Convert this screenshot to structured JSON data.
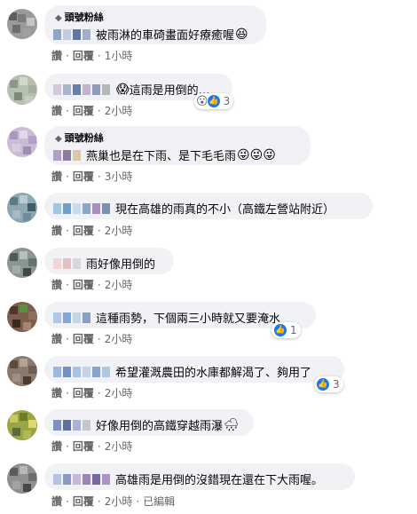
{
  "actions": {
    "like": "讚",
    "reply": "回覆",
    "sep": "·",
    "edited": "已編輯"
  },
  "comments": [
    {
      "badge": "頭號粉絲",
      "badge_icon": "diamond-icon",
      "text": "被雨淋的車碕畫面好療癒喔",
      "emoji": "😆",
      "time": "1小時"
    },
    {
      "text": "這雨是用倒的…",
      "emoji_prefix": "😱",
      "time": "2小時",
      "reactions": {
        "icons": [
          "wow-icon",
          "like-icon"
        ],
        "count": "3"
      }
    },
    {
      "badge": "頭號粉絲",
      "badge_icon": "diamond-icon",
      "text": "燕巢也是在下雨、是下毛毛雨",
      "emoji": "😜😜😜",
      "time": "3小時"
    },
    {
      "text": "現在高雄的雨真的不小（高鐵左營站附近）",
      "time": "2小時"
    },
    {
      "text": "雨好像用倒的",
      "time": "2小時"
    },
    {
      "text": "這種雨勢，下個兩三小時就又要淹水",
      "time": "2小時",
      "reactions": {
        "icons": [
          "like-icon"
        ],
        "count": "1"
      }
    },
    {
      "text": "希望灌溉農田的水庫都解渴了、夠用了",
      "time": "2小時",
      "reactions": {
        "icons": [
          "like-icon"
        ],
        "count": "3"
      }
    },
    {
      "text": "好像用倒的高鐵穿越雨瀑",
      "emoji": "🌧",
      "time": "2小時"
    },
    {
      "text": "高雄雨是用倒的沒錯現在還在下大雨喔。",
      "time": "2小時",
      "edited": true
    }
  ],
  "colors": {
    "bubble": "#f0f2f5",
    "like_blue": "#1877f2",
    "meta_gray": "#65676b"
  }
}
